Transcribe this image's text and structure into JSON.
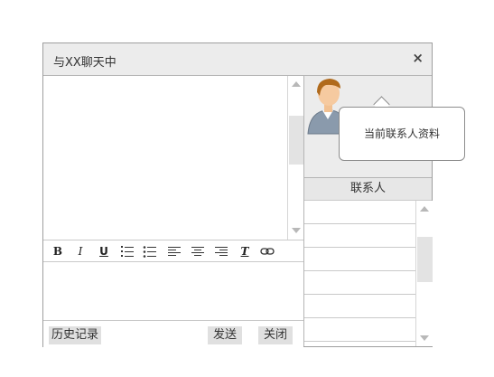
{
  "window": {
    "title": "与XX聊天中",
    "close_icon": "×"
  },
  "toolbar": {
    "bold": "B",
    "italic": "I",
    "underline": "U",
    "ordered_list_icon": "ordered-list-icon",
    "unordered_list_icon": "unordered-list-icon",
    "align_left_icon": "align-left-icon",
    "align_center_icon": "align-center-icon",
    "align_right_icon": "align-right-icon",
    "clear_format": "T",
    "link_icon": "link-icon"
  },
  "bottom": {
    "history": "历史记录",
    "send": "发送",
    "close": "关闭"
  },
  "profile": {
    "tooltip": "当前联系人资料",
    "avatar_icon": "user-avatar-icon"
  },
  "contacts": {
    "header": "联系人",
    "rows": [
      "",
      "",
      "",
      "",
      "",
      ""
    ]
  },
  "colors": {
    "titlebar": "#ececec",
    "border": "#9e9e9e",
    "button": "#e0e0e0"
  }
}
